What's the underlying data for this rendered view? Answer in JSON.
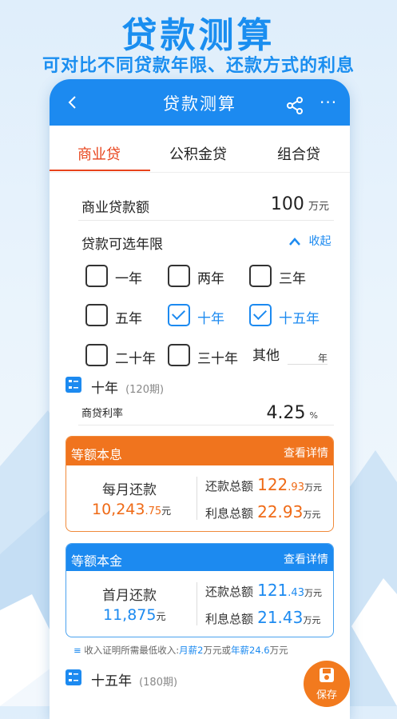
{
  "promo": {
    "title": "贷款测算",
    "subtitle": "可对比不同贷款年限、还款方式的利息"
  },
  "navbar": {
    "title": "贷款测算",
    "more": "···"
  },
  "tabs": [
    "商业贷",
    "公积金贷",
    "组合贷"
  ],
  "loan_amount": {
    "label": "商业贷款额",
    "value": "100",
    "unit": "万元"
  },
  "term": {
    "label": "贷款可选年限",
    "collapse": "收起",
    "options": [
      "一年",
      "两年",
      "三年",
      "五年",
      "十年",
      "十五年",
      "二十年",
      "三十年"
    ],
    "checked": [
      "十年",
      "十五年"
    ],
    "other_label": "其他",
    "other_unit": "年"
  },
  "section1": {
    "title": "十年",
    "periods": "(120期)",
    "rate_label": "商贷利率",
    "rate_value": "4.25",
    "rate_unit": "%",
    "card1": {
      "title": "等额本息",
      "detail": "查看详情",
      "monthly_label": "每月还款",
      "monthly_int": "10,243",
      "monthly_dec": ".75",
      "monthly_unit": "元",
      "total_label": "还款总额",
      "total_int": "122",
      "total_dec": ".93",
      "total_unit": "万元",
      "interest_label": "利息总额",
      "interest_value": "22.93",
      "interest_unit": "万元"
    },
    "card2": {
      "title": "等额本金",
      "detail": "查看详情",
      "monthly_label": "首月还款",
      "monthly_value": "11,875",
      "monthly_unit": "元",
      "total_label": "还款总额",
      "total_int": "121",
      "total_dec": ".43",
      "total_unit": "万元",
      "interest_label": "利息总额",
      "interest_value": "21.43",
      "interest_unit": "万元"
    },
    "income_note": {
      "prefix": "收入证明所需最低收入:",
      "monthly_label": "月薪",
      "monthly_value": "2",
      "monthly_unit": "万元或",
      "yearly_label": "年薪",
      "yearly_value": "24.6",
      "yearly_unit": "万元"
    }
  },
  "section2": {
    "title": "十五年",
    "periods": "(180期)"
  },
  "save": {
    "label": "保存"
  },
  "colors": {
    "primary": "#1c8af0",
    "accent": "#e8431b",
    "orange": "#ef6a16"
  }
}
